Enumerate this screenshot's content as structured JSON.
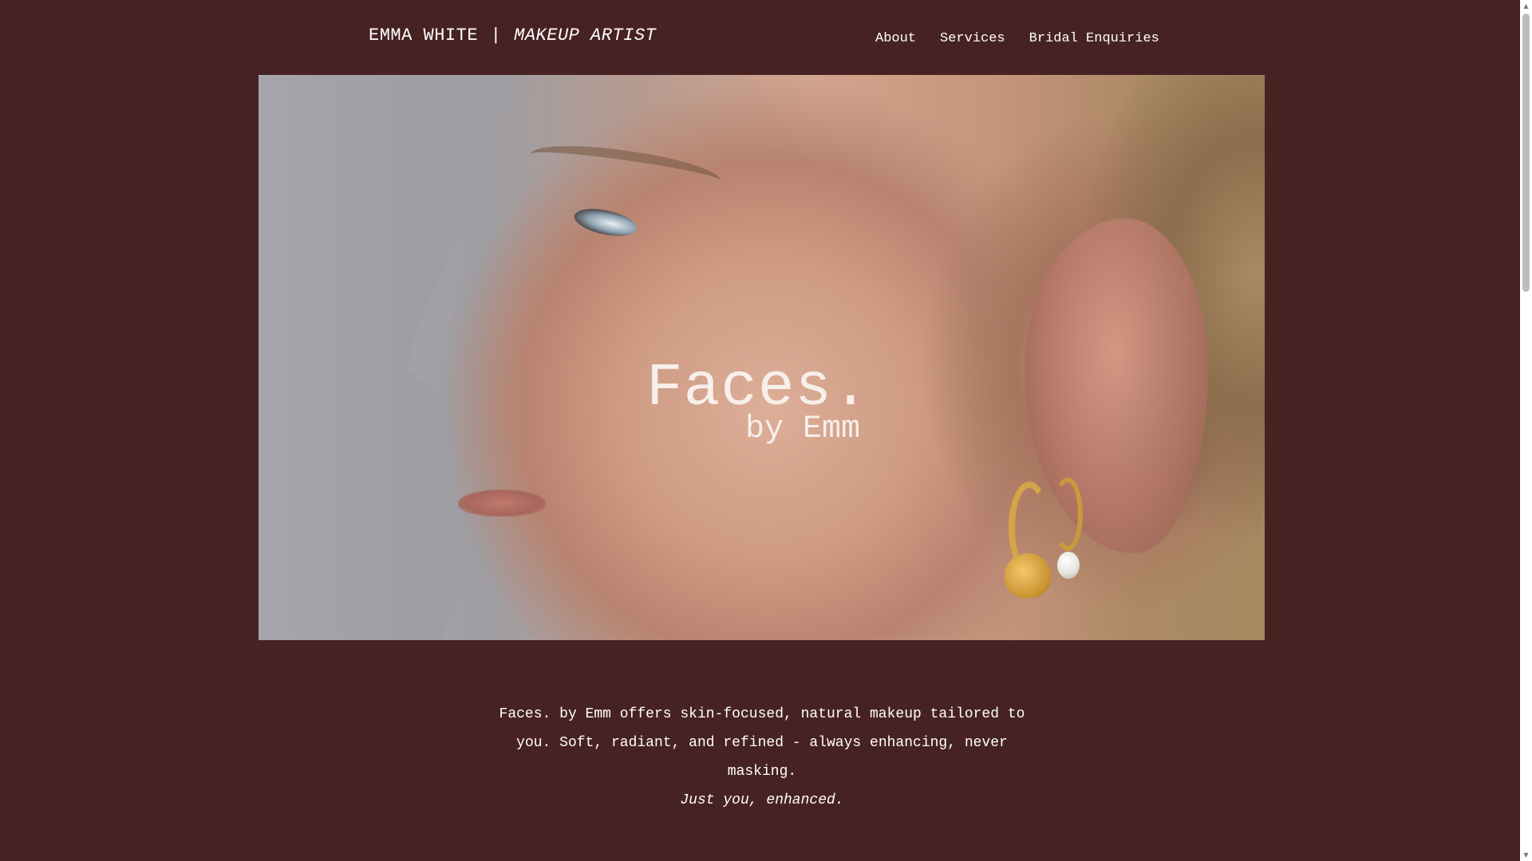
{
  "header": {
    "brand_name": "EMMA WHITE",
    "brand_separator": "|",
    "brand_role": "MAKEUP ARTIST",
    "nav": [
      {
        "label": "About"
      },
      {
        "label": "Services"
      },
      {
        "label": "Bridal Enquiries"
      }
    ]
  },
  "hero": {
    "title": "Faces.",
    "subtitle": "by Emm"
  },
  "intro": {
    "paragraph": "Faces. by Emm offers skin-focused, natural makeup tailored to you. Soft, radiant, and refined - always enhancing, never masking.",
    "tagline": "Just you, enhanced."
  },
  "colors": {
    "background": "#472223",
    "text": "#ffffff"
  },
  "scrollbar": {
    "up_icon": "scroll-up-arrow-icon",
    "down_icon": "scroll-down-arrow-icon"
  }
}
